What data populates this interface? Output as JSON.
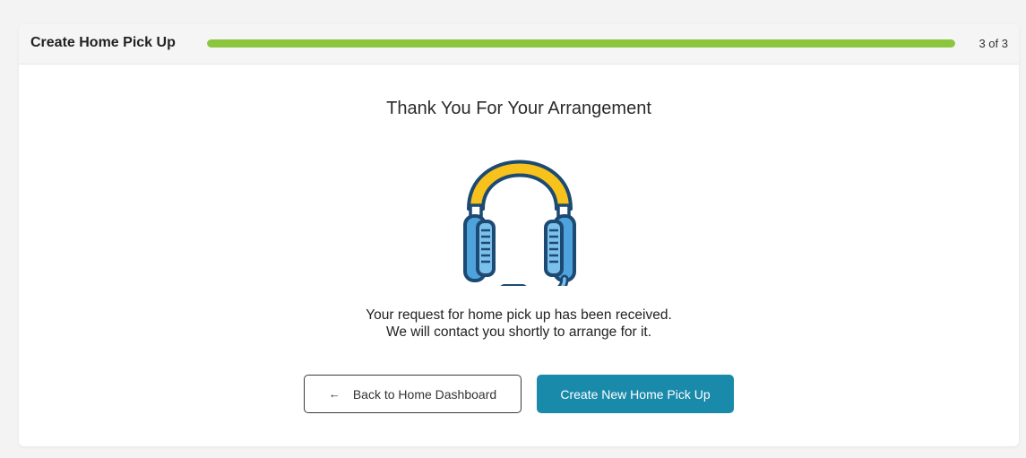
{
  "header": {
    "title": "Create Home Pick Up",
    "step_text": "3 of 3",
    "progress_fraction": 1.0,
    "progress_color": "#8cc63f"
  },
  "main": {
    "heading": "Thank You For Your Arrangement",
    "illustration_icon": "headset-icon",
    "message_line1": "Your request for home pick up has been received.",
    "message_line2": "We will contact you shortly to arrange for it."
  },
  "actions": {
    "back_icon": "arrow-left-icon",
    "back_arrow_glyph": "←",
    "back_label": "Back to Home Dashboard",
    "new_label": "Create New Home Pick Up",
    "primary_color": "#1a8aab"
  }
}
